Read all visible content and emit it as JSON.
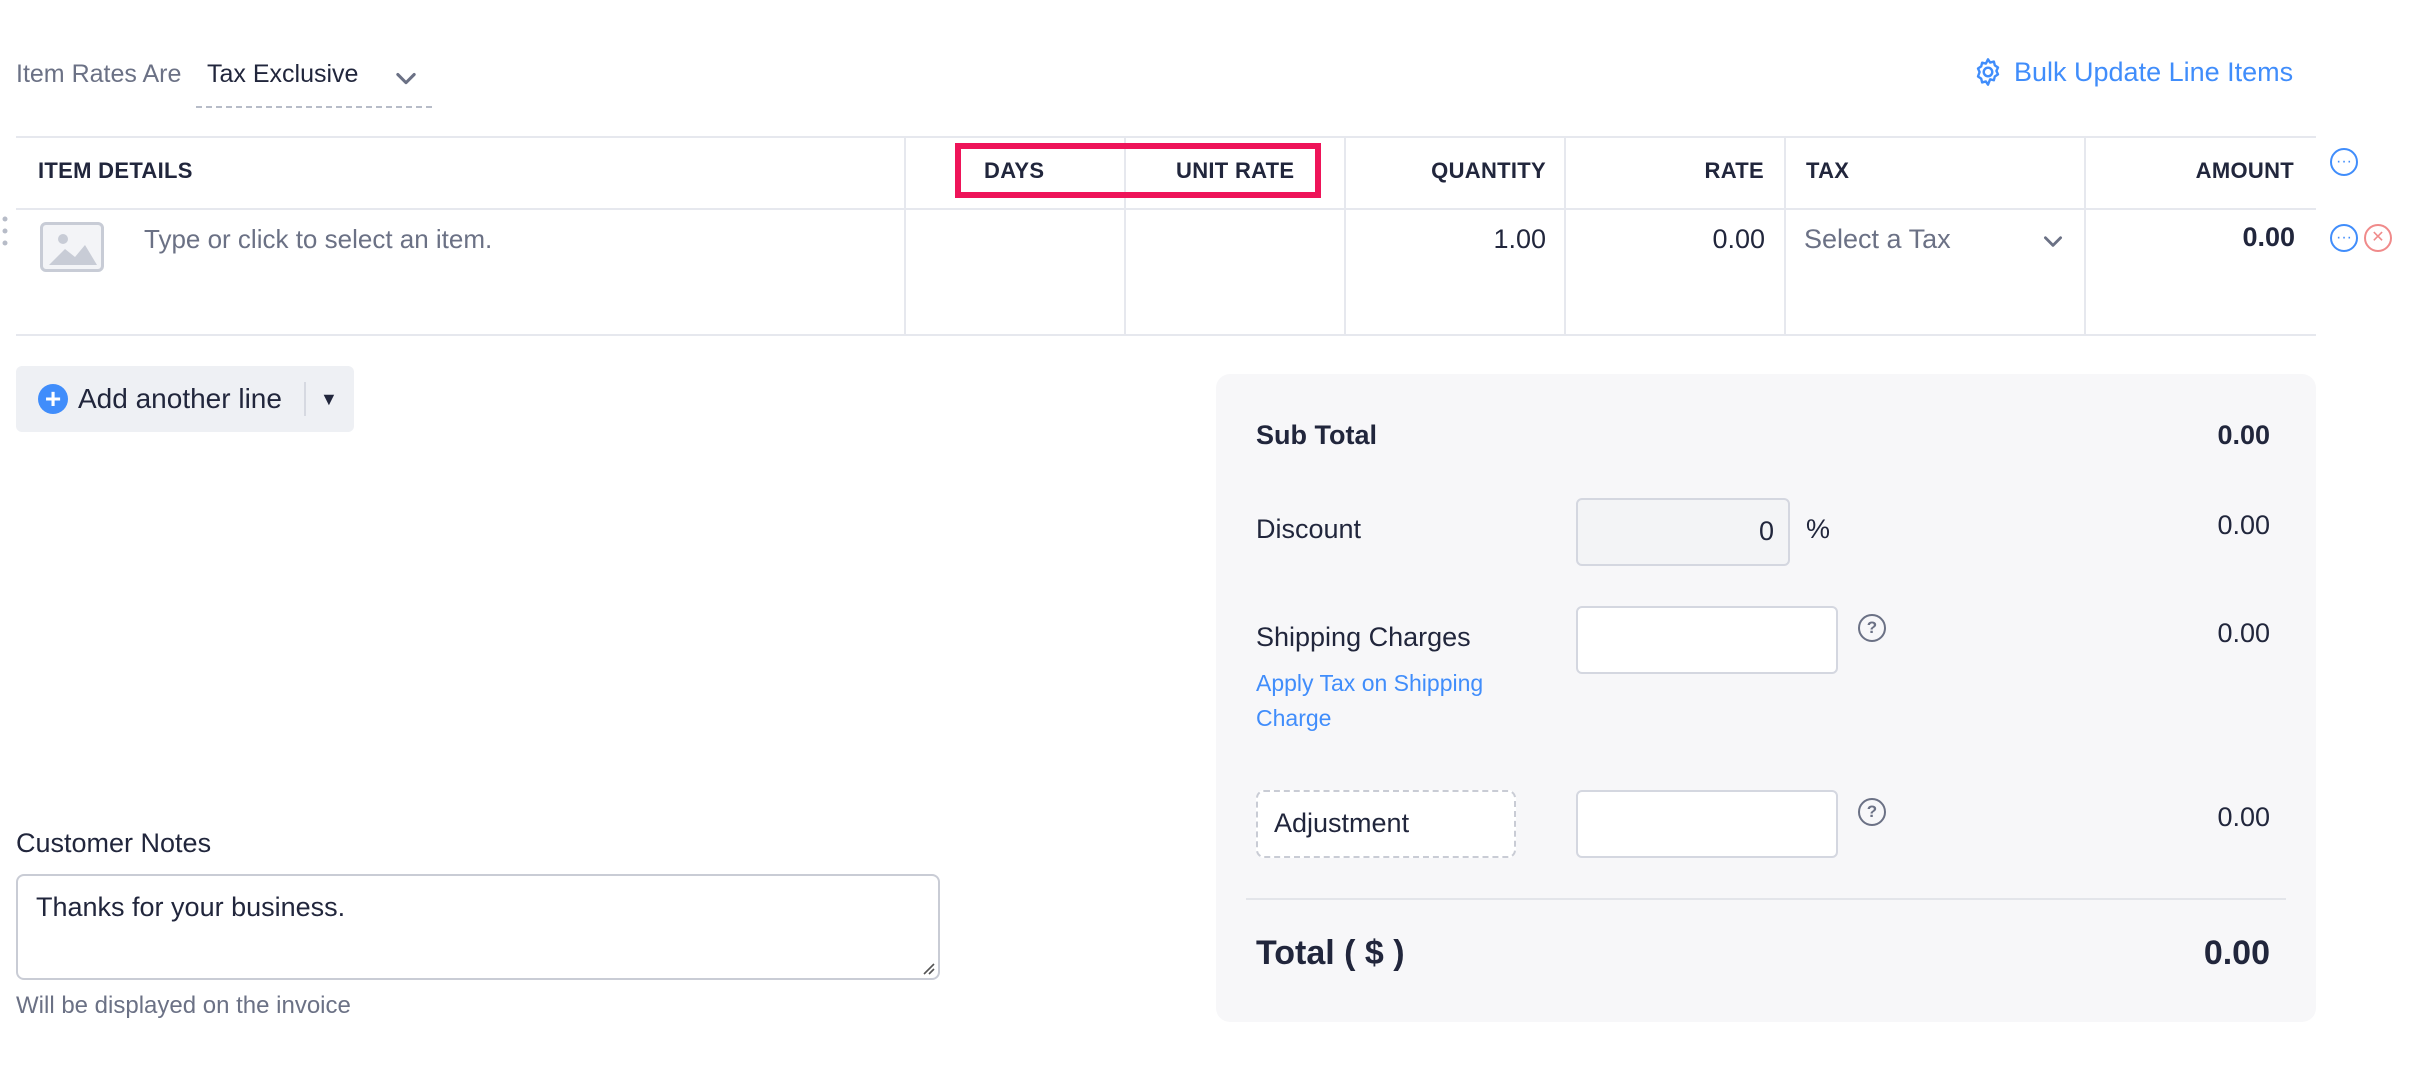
{
  "header": {
    "rates_label": "Item Rates Are",
    "rates_value": "Tax Exclusive",
    "bulk_update": "Bulk Update Line Items"
  },
  "table": {
    "columns": {
      "item_details": "ITEM DETAILS",
      "days": "DAYS",
      "unit_rate": "UNIT RATE",
      "quantity": "QUANTITY",
      "rate": "RATE",
      "tax": "TAX",
      "amount": "AMOUNT"
    },
    "row": {
      "item_placeholder": "Type or click to select an item.",
      "quantity": "1.00",
      "rate": "0.00",
      "tax_placeholder": "Select a Tax",
      "amount": "0.00"
    }
  },
  "add_line": {
    "label": "Add another line"
  },
  "totals": {
    "sub_total_label": "Sub Total",
    "sub_total_value": "0.00",
    "discount_label": "Discount",
    "discount_input": "0",
    "discount_unit": "%",
    "discount_value": "0.00",
    "shipping_label": "Shipping Charges",
    "shipping_link": "Apply Tax on Shipping Charge",
    "shipping_value": "0.00",
    "adjustment_label": "Adjustment",
    "adjustment_value": "0.00",
    "total_label": "Total ( $ )",
    "total_value": "0.00"
  },
  "notes": {
    "label": "Customer Notes",
    "value": "Thanks for your business.",
    "hint": "Will be displayed on the invoice"
  },
  "colors": {
    "accent": "#408dfb",
    "highlight": "#ee1459"
  }
}
